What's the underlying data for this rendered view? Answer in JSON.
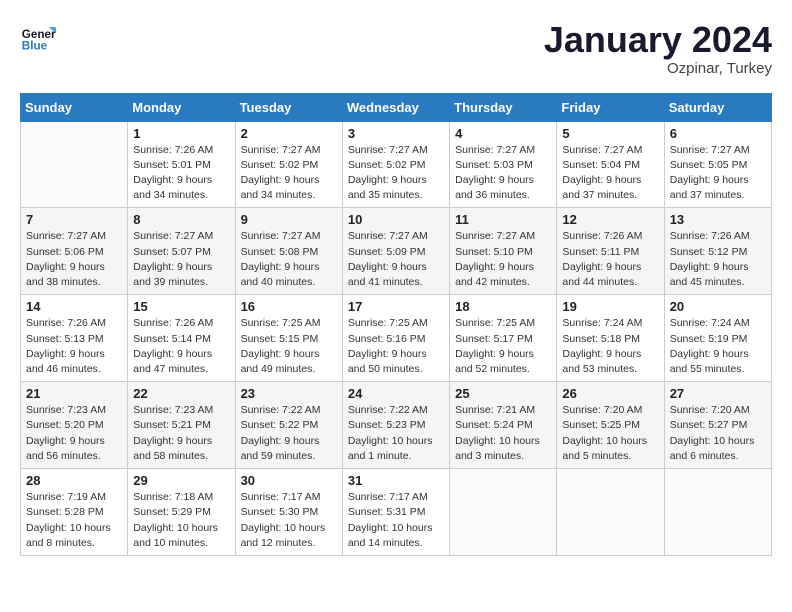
{
  "header": {
    "logo": {
      "line1": "General",
      "line2": "Blue"
    },
    "title": "January 2024",
    "location": "Ozpinar, Turkey"
  },
  "columns": [
    "Sunday",
    "Monday",
    "Tuesday",
    "Wednesday",
    "Thursday",
    "Friday",
    "Saturday"
  ],
  "weeks": [
    [
      {
        "day": "",
        "info": ""
      },
      {
        "day": "1",
        "info": "Sunrise: 7:26 AM\nSunset: 5:01 PM\nDaylight: 9 hours\nand 34 minutes."
      },
      {
        "day": "2",
        "info": "Sunrise: 7:27 AM\nSunset: 5:02 PM\nDaylight: 9 hours\nand 34 minutes."
      },
      {
        "day": "3",
        "info": "Sunrise: 7:27 AM\nSunset: 5:02 PM\nDaylight: 9 hours\nand 35 minutes."
      },
      {
        "day": "4",
        "info": "Sunrise: 7:27 AM\nSunset: 5:03 PM\nDaylight: 9 hours\nand 36 minutes."
      },
      {
        "day": "5",
        "info": "Sunrise: 7:27 AM\nSunset: 5:04 PM\nDaylight: 9 hours\nand 37 minutes."
      },
      {
        "day": "6",
        "info": "Sunrise: 7:27 AM\nSunset: 5:05 PM\nDaylight: 9 hours\nand 37 minutes."
      }
    ],
    [
      {
        "day": "7",
        "info": "Sunrise: 7:27 AM\nSunset: 5:06 PM\nDaylight: 9 hours\nand 38 minutes."
      },
      {
        "day": "8",
        "info": "Sunrise: 7:27 AM\nSunset: 5:07 PM\nDaylight: 9 hours\nand 39 minutes."
      },
      {
        "day": "9",
        "info": "Sunrise: 7:27 AM\nSunset: 5:08 PM\nDaylight: 9 hours\nand 40 minutes."
      },
      {
        "day": "10",
        "info": "Sunrise: 7:27 AM\nSunset: 5:09 PM\nDaylight: 9 hours\nand 41 minutes."
      },
      {
        "day": "11",
        "info": "Sunrise: 7:27 AM\nSunset: 5:10 PM\nDaylight: 9 hours\nand 42 minutes."
      },
      {
        "day": "12",
        "info": "Sunrise: 7:26 AM\nSunset: 5:11 PM\nDaylight: 9 hours\nand 44 minutes."
      },
      {
        "day": "13",
        "info": "Sunrise: 7:26 AM\nSunset: 5:12 PM\nDaylight: 9 hours\nand 45 minutes."
      }
    ],
    [
      {
        "day": "14",
        "info": "Sunrise: 7:26 AM\nSunset: 5:13 PM\nDaylight: 9 hours\nand 46 minutes."
      },
      {
        "day": "15",
        "info": "Sunrise: 7:26 AM\nSunset: 5:14 PM\nDaylight: 9 hours\nand 47 minutes."
      },
      {
        "day": "16",
        "info": "Sunrise: 7:25 AM\nSunset: 5:15 PM\nDaylight: 9 hours\nand 49 minutes."
      },
      {
        "day": "17",
        "info": "Sunrise: 7:25 AM\nSunset: 5:16 PM\nDaylight: 9 hours\nand 50 minutes."
      },
      {
        "day": "18",
        "info": "Sunrise: 7:25 AM\nSunset: 5:17 PM\nDaylight: 9 hours\nand 52 minutes."
      },
      {
        "day": "19",
        "info": "Sunrise: 7:24 AM\nSunset: 5:18 PM\nDaylight: 9 hours\nand 53 minutes."
      },
      {
        "day": "20",
        "info": "Sunrise: 7:24 AM\nSunset: 5:19 PM\nDaylight: 9 hours\nand 55 minutes."
      }
    ],
    [
      {
        "day": "21",
        "info": "Sunrise: 7:23 AM\nSunset: 5:20 PM\nDaylight: 9 hours\nand 56 minutes."
      },
      {
        "day": "22",
        "info": "Sunrise: 7:23 AM\nSunset: 5:21 PM\nDaylight: 9 hours\nand 58 minutes."
      },
      {
        "day": "23",
        "info": "Sunrise: 7:22 AM\nSunset: 5:22 PM\nDaylight: 9 hours\nand 59 minutes."
      },
      {
        "day": "24",
        "info": "Sunrise: 7:22 AM\nSunset: 5:23 PM\nDaylight: 10 hours\nand 1 minute."
      },
      {
        "day": "25",
        "info": "Sunrise: 7:21 AM\nSunset: 5:24 PM\nDaylight: 10 hours\nand 3 minutes."
      },
      {
        "day": "26",
        "info": "Sunrise: 7:20 AM\nSunset: 5:25 PM\nDaylight: 10 hours\nand 5 minutes."
      },
      {
        "day": "27",
        "info": "Sunrise: 7:20 AM\nSunset: 5:27 PM\nDaylight: 10 hours\nand 6 minutes."
      }
    ],
    [
      {
        "day": "28",
        "info": "Sunrise: 7:19 AM\nSunset: 5:28 PM\nDaylight: 10 hours\nand 8 minutes."
      },
      {
        "day": "29",
        "info": "Sunrise: 7:18 AM\nSunset: 5:29 PM\nDaylight: 10 hours\nand 10 minutes."
      },
      {
        "day": "30",
        "info": "Sunrise: 7:17 AM\nSunset: 5:30 PM\nDaylight: 10 hours\nand 12 minutes."
      },
      {
        "day": "31",
        "info": "Sunrise: 7:17 AM\nSunset: 5:31 PM\nDaylight: 10 hours\nand 14 minutes."
      },
      {
        "day": "",
        "info": ""
      },
      {
        "day": "",
        "info": ""
      },
      {
        "day": "",
        "info": ""
      }
    ]
  ]
}
